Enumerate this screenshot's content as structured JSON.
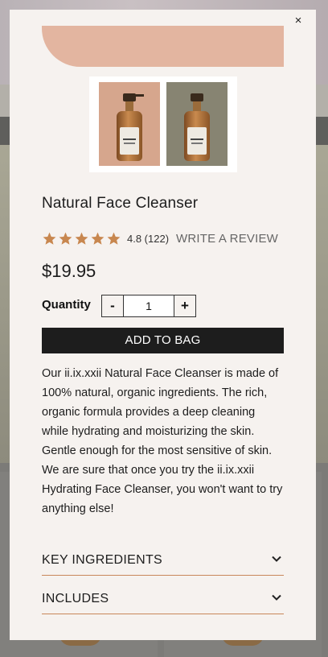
{
  "product": {
    "title": "Natural Face Cleanser",
    "rating_text": "4.8 (122)",
    "review_link": "WRITE A REVIEW",
    "price": "$19.95",
    "quantity_label": "Quantity",
    "quantity_value": "1",
    "decrement_label": "-",
    "increment_label": "+",
    "add_to_bag": "ADD TO BAG",
    "description": "Our ii.ix.xxii Natural Face Cleanser is made of 100% natural, organic ingredients. The rich, organic formula provides a deep cleaning while hydrating and moisturizing the skin. Gentle enough for the most sensitive of skin. We are sure that once you try the ii.ix.xxii Hydrating Face Cleanser, you won't want to try anything else!",
    "stars": 5,
    "star_color": "#c8874f"
  },
  "modal": {
    "close_label": "×"
  },
  "accordions": [
    {
      "label": "KEY INGREDIENTS",
      "icon": "chevron-down-icon"
    },
    {
      "label": "INCLUDES",
      "icon": "chevron-down-icon"
    }
  ],
  "colors": {
    "accent": "#c8875a",
    "hero": "#e3b5a0",
    "button": "#1d1d1d"
  }
}
